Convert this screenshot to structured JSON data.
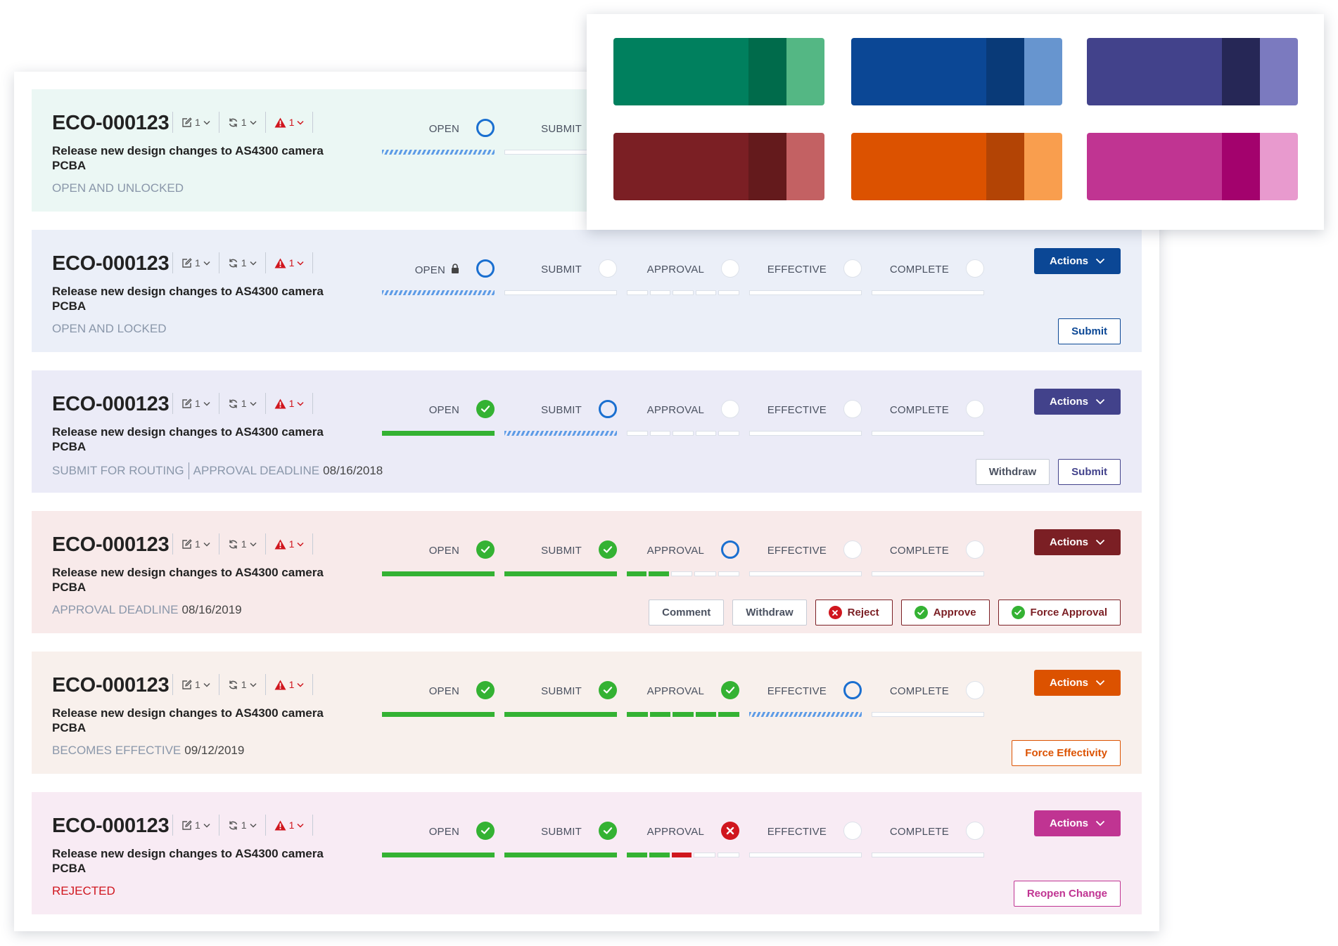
{
  "palette": [
    {
      "name": "green",
      "main": "#00805e",
      "dark": "#006b4b",
      "light": "#54b784"
    },
    {
      "name": "blue",
      "main": "#0b4795",
      "dark": "#093a78",
      "light": "#6795cf"
    },
    {
      "name": "indigo",
      "main": "#42428b",
      "dark": "#262756",
      "light": "#7b7abf"
    },
    {
      "name": "maroon",
      "main": "#7b1f24",
      "dark": "#641a1c",
      "light": "#c36163"
    },
    {
      "name": "orange",
      "main": "#dc5200",
      "dark": "#b34405",
      "light": "#f99e4e"
    },
    {
      "name": "magenta",
      "main": "#c03492",
      "dark": "#a3026d",
      "light": "#e89ace"
    }
  ],
  "step_labels": [
    "OPEN",
    "SUBMIT",
    "APPROVAL",
    "EFFECTIVE",
    "COMPLETE"
  ],
  "actions_label": "Actions",
  "cards": [
    {
      "id": "ECO-000123",
      "edits": "1",
      "revisions": "1",
      "alerts": "1",
      "description": "Release new design changes to AS4300 camera PCBA",
      "status_label": "OPEN AND UNLOCKED",
      "bg": "#ebf7f4",
      "accent": "#00805e",
      "steps": [
        "current",
        "pending",
        "pending",
        "pending",
        "pending"
      ],
      "bars": [
        "progress",
        "empty",
        "empty",
        "empty",
        "empty"
      ],
      "approval_segments": [
        "empty",
        "empty",
        "empty",
        "empty",
        "empty"
      ],
      "locked": false,
      "buttons": []
    },
    {
      "id": "ECO-000123",
      "edits": "1",
      "revisions": "1",
      "alerts": "1",
      "description": "Release new design changes to AS4300 camera PCBA",
      "status_label": "OPEN AND LOCKED",
      "bg": "#ebeff8",
      "accent": "#0b4795",
      "steps": [
        "current",
        "pending",
        "pending",
        "pending",
        "pending"
      ],
      "bars": [
        "progress",
        "empty",
        "segments",
        "empty",
        "empty"
      ],
      "approval_segments": [
        "empty",
        "empty",
        "empty",
        "empty",
        "empty"
      ],
      "locked": true,
      "buttons": [
        {
          "label": "Submit",
          "style": "accent"
        }
      ]
    },
    {
      "id": "ECO-000123",
      "edits": "1",
      "revisions": "1",
      "alerts": "1",
      "description": "Release new design changes to AS4300 camera PCBA",
      "status_label": "SUBMIT FOR ROUTING",
      "status_extra_label": "APPROVAL DEADLINE",
      "status_value": "08/16/2018",
      "bg": "#ebebf7",
      "accent": "#42428b",
      "steps": [
        "done",
        "current",
        "pending",
        "pending",
        "pending"
      ],
      "bars": [
        "done",
        "progress",
        "segments",
        "empty",
        "empty"
      ],
      "approval_segments": [
        "empty",
        "empty",
        "empty",
        "empty",
        "empty"
      ],
      "locked": false,
      "buttons": [
        {
          "label": "Withdraw",
          "style": "neutral"
        },
        {
          "label": "Submit",
          "style": "accent"
        }
      ]
    },
    {
      "id": "ECO-000123",
      "edits": "1",
      "revisions": "1",
      "alerts": "1",
      "description": "Release new design changes to AS4300 camera PCBA",
      "status_label": "APPROVAL DEADLINE",
      "status_value": "08/16/2019",
      "bg": "#f8eaea",
      "accent": "#7b1f24",
      "steps": [
        "done",
        "done",
        "current",
        "pending",
        "pending"
      ],
      "bars": [
        "done",
        "done",
        "segments",
        "empty",
        "empty"
      ],
      "approval_segments": [
        "done",
        "done",
        "empty",
        "empty",
        "empty"
      ],
      "locked": false,
      "buttons": [
        {
          "label": "Comment",
          "style": "neutral"
        },
        {
          "label": "Withdraw",
          "style": "neutral"
        },
        {
          "label": "Reject",
          "style": "accent",
          "icon": "reject"
        },
        {
          "label": "Approve",
          "style": "accent",
          "icon": "approve"
        },
        {
          "label": "Force Approval",
          "style": "accent",
          "icon": "approve"
        }
      ]
    },
    {
      "id": "ECO-000123",
      "edits": "1",
      "revisions": "1",
      "alerts": "1",
      "description": "Release new design changes to AS4300 camera PCBA",
      "status_label": "BECOMES EFFECTIVE",
      "status_value": "09/12/2019",
      "bg": "#f8f0ec",
      "accent": "#dc5200",
      "steps": [
        "done",
        "done",
        "done",
        "current",
        "pending"
      ],
      "bars": [
        "done",
        "done",
        "segments",
        "progress",
        "empty"
      ],
      "approval_segments": [
        "done",
        "done",
        "done",
        "done",
        "done"
      ],
      "locked": false,
      "buttons": [
        {
          "label": "Force Effectivity",
          "style": "accent"
        }
      ]
    },
    {
      "id": "ECO-000123",
      "edits": "1",
      "revisions": "1",
      "alerts": "1",
      "description": "Release new design changes to AS4300 camera PCBA",
      "status_label": "REJECTED",
      "status_rejected": true,
      "bg": "#f8ebf4",
      "accent": "#c03492",
      "steps": [
        "done",
        "done",
        "failed",
        "pending",
        "pending"
      ],
      "bars": [
        "done",
        "done",
        "segments",
        "empty",
        "empty"
      ],
      "approval_segments": [
        "done",
        "done",
        "failed",
        "empty",
        "empty"
      ],
      "locked": false,
      "buttons": [
        {
          "label": "Reopen Change",
          "style": "accent"
        }
      ]
    }
  ]
}
